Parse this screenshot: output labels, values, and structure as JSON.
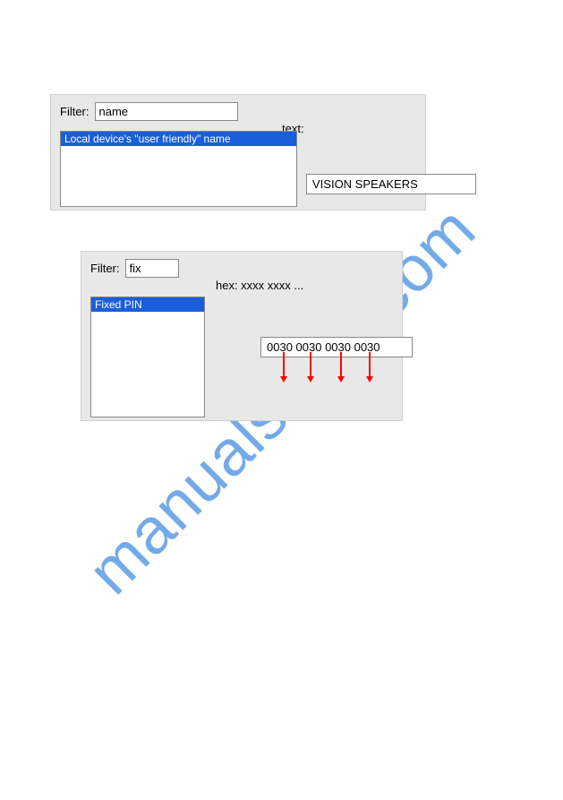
{
  "watermark": "manualshive.com",
  "panel1": {
    "filter_label": "Filter:",
    "filter_value": "name",
    "right_label": "text:",
    "list_item": "Local device's \"user friendly\" name",
    "value": "VISION SPEAKERS"
  },
  "panel2": {
    "filter_label": "Filter:",
    "filter_value": "fix",
    "right_label": "hex: xxxx xxxx ...",
    "list_item": "Fixed PIN",
    "value": "0030 0030 0030 0030"
  }
}
